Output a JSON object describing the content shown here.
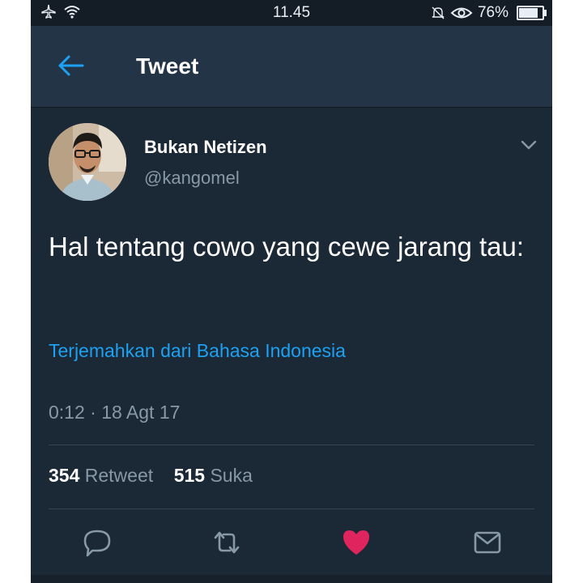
{
  "status_bar": {
    "time": "11.45",
    "battery": "76%",
    "battery_level": 0.76,
    "left_icons": [
      "airplane-icon",
      "wifi-icon"
    ],
    "right_icons": [
      "bell-muted-icon",
      "eye-icon",
      "battery-icon"
    ]
  },
  "header": {
    "title": "Tweet",
    "back_icon": "back-arrow-icon"
  },
  "tweet": {
    "display_name": "Bukan Netizen",
    "handle": "@kangomel",
    "text": "Hal tentang cowo yang cewe jarang tau:",
    "translate_link": "Terjemahkan dari Bahasa Indonesia",
    "timestamp": "0:12 · 18 Agt 17",
    "retweet_count": "354",
    "retweet_label": "Retweet",
    "like_count": "515",
    "like_label": "Suka"
  },
  "actions": [
    "reply-icon",
    "retweet-icon",
    "like-icon",
    "share-icon"
  ],
  "colors": {
    "background": "#1b2836",
    "header": "#243447",
    "accent": "#1da1f2",
    "like": "#e0245e",
    "muted": "#8899a6"
  }
}
